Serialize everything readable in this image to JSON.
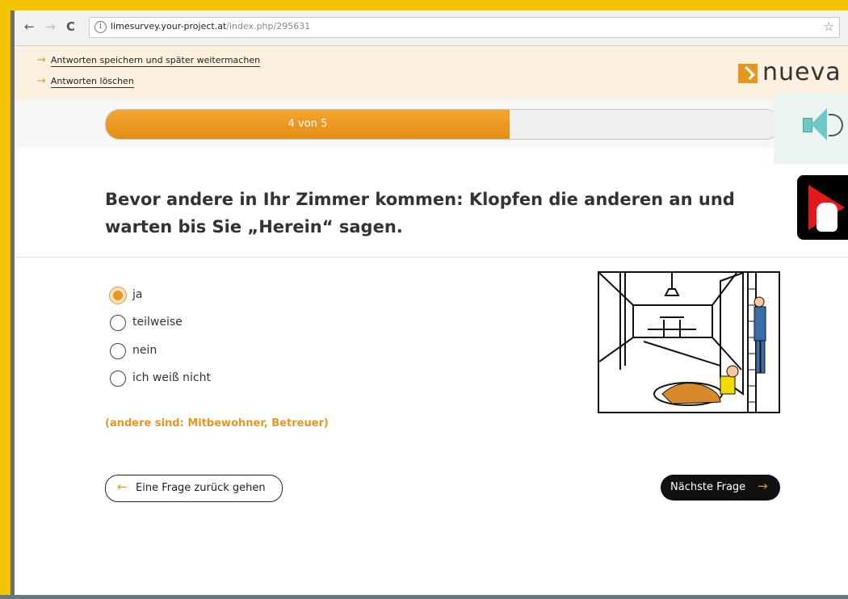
{
  "browser": {
    "url_host": "limesurvey.your-project.at",
    "url_path": "/index.php/295631",
    "back_glyph": "←",
    "forward_glyph": "→",
    "reload_glyph": "C",
    "star_glyph": "☆"
  },
  "top_links": [
    {
      "label": "Antworten speichern und später weitermachen"
    },
    {
      "label": "Antworten löschen"
    }
  ],
  "logo": {
    "text": "nueva"
  },
  "progress": {
    "label": "4 von 5",
    "fraction": 0.6
  },
  "question": {
    "text": "Bevor andere in Ihr Zimmer kommen: Klopfen die anderen an und warten bis Sie „Herein“ sagen."
  },
  "options": [
    {
      "label": "ja",
      "selected": true
    },
    {
      "label": "teilweise",
      "selected": false
    },
    {
      "label": "nein",
      "selected": false
    },
    {
      "label": "ich weiß nicht",
      "selected": false
    }
  ],
  "note": "(andere sind: Mitbewohner, Betreuer)",
  "buttons": {
    "back_label": "Eine Frage zurück gehen",
    "next_label": "Nächste Frage",
    "arrow_left": "←",
    "arrow_right": "→"
  },
  "colors": {
    "accent": "#e8961f",
    "frame": "#f5c400",
    "top_band": "#fcf0e1"
  },
  "icons": [
    "audio-speaker-icon",
    "video-play-hand-icon",
    "info-icon",
    "star-icon"
  ]
}
